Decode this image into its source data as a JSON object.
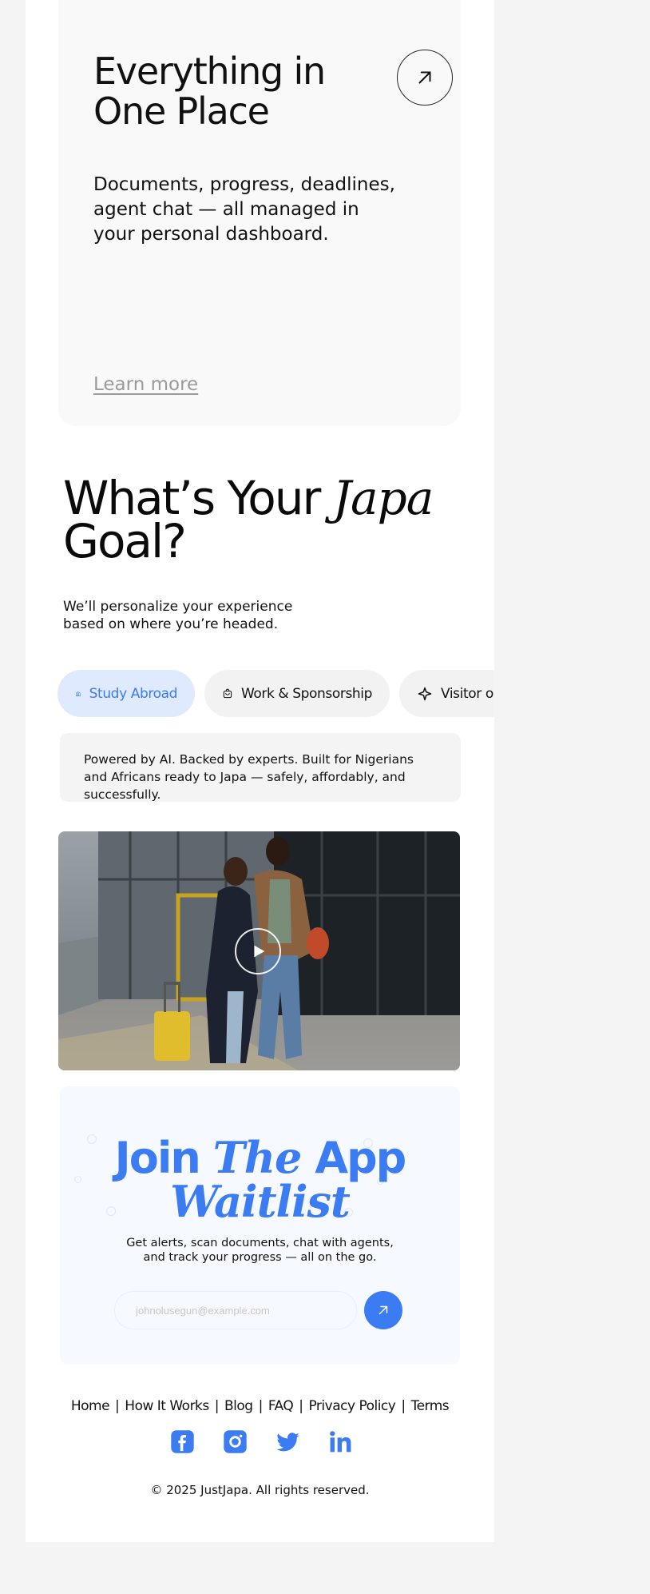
{
  "feature": {
    "title": "Everything in One Place",
    "description": "Documents, progress, deadlines, agent chat — all managed in your personal dashboard.",
    "learn_more": "Learn more",
    "arrow_icon": "arrow-up-right-icon"
  },
  "goal": {
    "title_prefix": "What’s Your",
    "title_accent": "Japa",
    "title_suffix": "Goal?",
    "subtitle": "We’ll personalize your experience based on where you’re headed.",
    "chips": [
      {
        "label": "Study Abroad",
        "icon": "school-icon",
        "active": true
      },
      {
        "label": "Work & Sponsorship",
        "icon": "briefcase-icon",
        "active": false
      },
      {
        "label": "Visitor or T",
        "icon": "plane-icon",
        "active": false
      }
    ]
  },
  "powered_text": "Powered by AI. Backed by experts. Built for Nigerians and Africans ready to Japa — safely, affordably, and successfully.",
  "video": {
    "play_icon": "play-icon"
  },
  "waitlist": {
    "title_join": "Join",
    "title_accent_1": "The",
    "title_app": "App",
    "title_accent_2": "Waitlist",
    "subtitle": "Get alerts, scan documents, chat with agents, and track your progress — all on the go.",
    "email_placeholder": "johnolusegun@example.com",
    "submit_icon": "arrow-up-right-icon"
  },
  "footer": {
    "links": [
      "Home",
      "How It Works",
      "Blog",
      "FAQ",
      "Privacy Policy",
      "Terms"
    ],
    "separator": "|",
    "socials": [
      "facebook-icon",
      "instagram-icon",
      "twitter-icon",
      "linkedin-icon"
    ],
    "copyright": "© 2025 JustJapa. All rights reserved."
  },
  "colors": {
    "accent": "#3b7cf2",
    "chip_active_bg": "#dfeafe",
    "page_bg": "#f4f4f4"
  }
}
